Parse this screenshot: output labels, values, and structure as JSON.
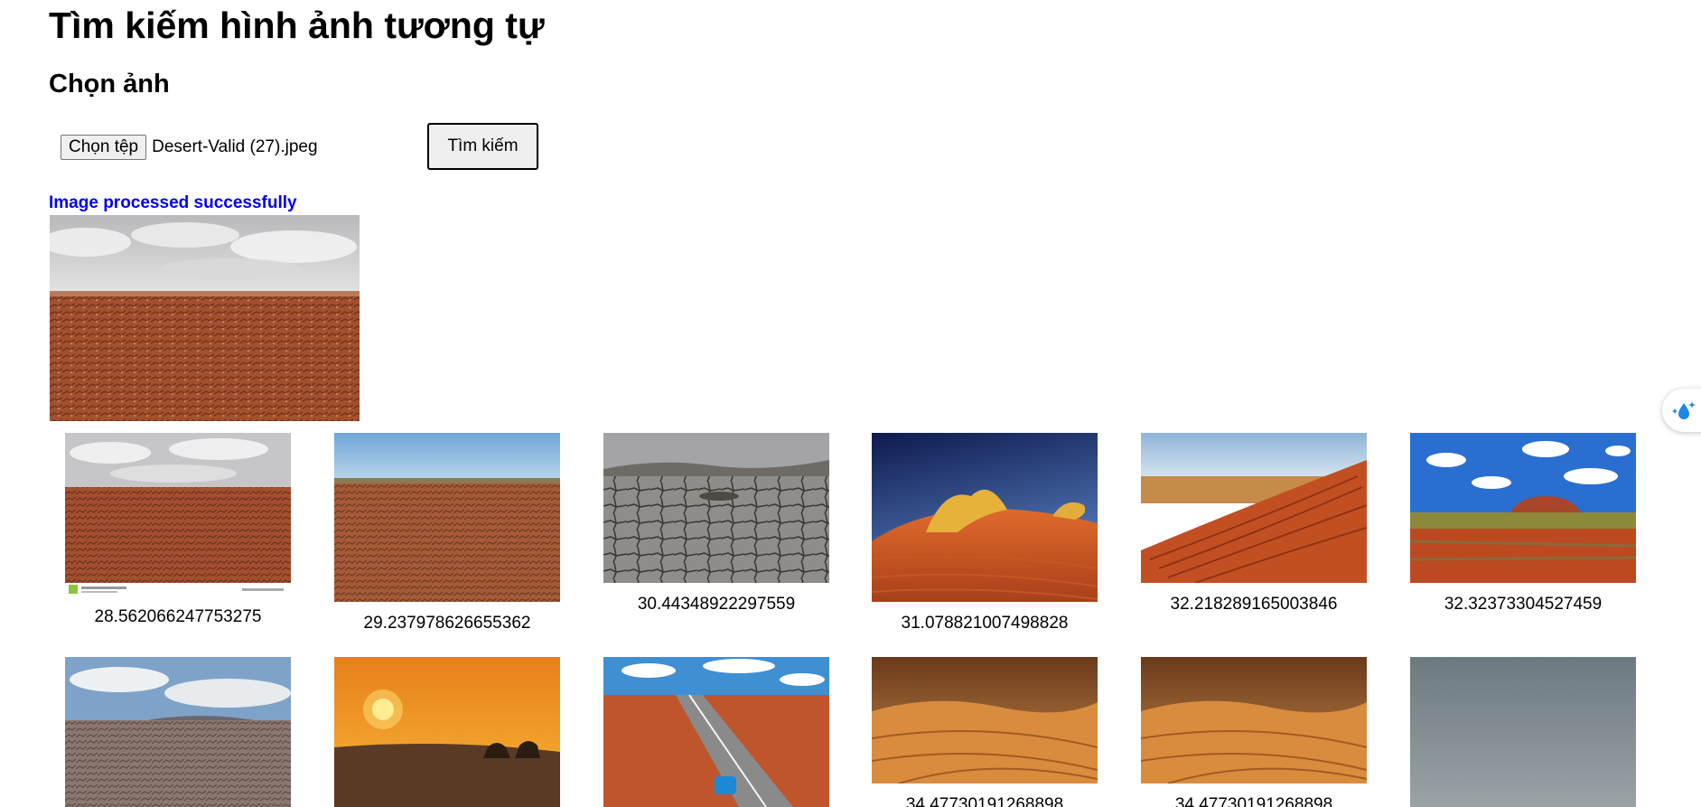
{
  "header": {
    "title": "Tìm kiếm hình ảnh tương tự",
    "subtitle": "Chọn ảnh"
  },
  "form": {
    "file_button_label": "Chọn tệp",
    "file_name": "Desert-Valid (27).jpeg",
    "search_button_label": "Tìm kiếm"
  },
  "status": {
    "message": "Image processed successfully",
    "color": "#0000ee"
  },
  "results": [
    {
      "score": "28.562066247753275",
      "scene": "cracked-red-earth-cloudy-watermarked"
    },
    {
      "score": "29.237978626655362",
      "scene": "red-rocky-plain-blue-sky"
    },
    {
      "score": "30.44348922297559",
      "scene": "dry-cracked-lakebed-grey"
    },
    {
      "score": "31.078821007498828",
      "scene": "red-dune-yellow-grass-dark-sky"
    },
    {
      "score": "32.218289165003846",
      "scene": "rippled-red-dune"
    },
    {
      "score": "32.32373304527459",
      "scene": "red-outback-rock-clouds"
    },
    {
      "score": "",
      "scene": "stony-plain-cloudy-sky"
    },
    {
      "score": "",
      "scene": "desert-sunset-camels"
    },
    {
      "score": "",
      "scene": "outback-road-blue-car"
    },
    {
      "score": "34.47730191268898",
      "scene": "orange-dunes-ridge"
    },
    {
      "score": "34.47730191268898",
      "scene": "orange-dunes-ridge"
    },
    {
      "score": "",
      "scene": "grey-haze-blank"
    }
  ]
}
